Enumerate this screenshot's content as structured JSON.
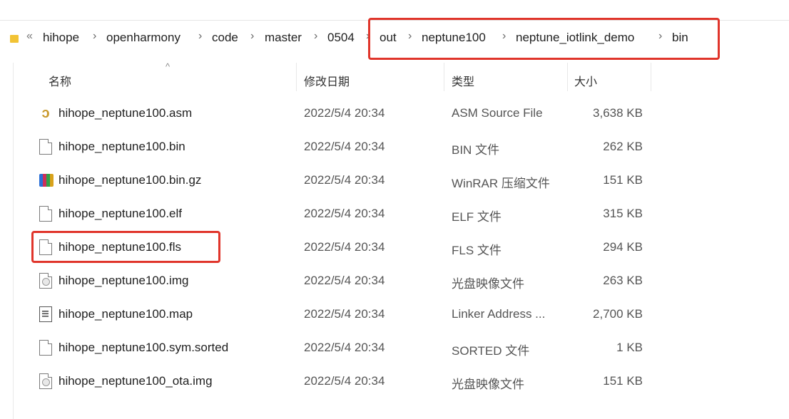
{
  "breadcrumb": {
    "overflow": "«",
    "separator": "›",
    "segments": [
      "hihope",
      "openharmony",
      "code",
      "master",
      "0504",
      "out",
      "neptune100",
      "neptune_iotlink_demo",
      "bin"
    ]
  },
  "columns": {
    "name": "名称",
    "date": "修改日期",
    "type": "类型",
    "size": "大小"
  },
  "files": [
    {
      "name": "hihope_neptune100.asm",
      "date": "2022/5/4 20:34",
      "type": "ASM Source File",
      "size": "3,638 KB",
      "icon": "asm-file-icon"
    },
    {
      "name": "hihope_neptune100.bin",
      "date": "2022/5/4 20:34",
      "type": "BIN 文件",
      "size": "262 KB",
      "icon": "file-icon"
    },
    {
      "name": "hihope_neptune100.bin.gz",
      "date": "2022/5/4 20:34",
      "type": "WinRAR 压缩文件",
      "size": "151 KB",
      "icon": "winrar-icon"
    },
    {
      "name": "hihope_neptune100.elf",
      "date": "2022/5/4 20:34",
      "type": "ELF 文件",
      "size": "315 KB",
      "icon": "file-icon"
    },
    {
      "name": "hihope_neptune100.fls",
      "date": "2022/5/4 20:34",
      "type": "FLS 文件",
      "size": "294 KB",
      "icon": "file-icon"
    },
    {
      "name": "hihope_neptune100.img",
      "date": "2022/5/4 20:34",
      "type": "光盘映像文件",
      "size": "263 KB",
      "icon": "disc-image-icon"
    },
    {
      "name": "hihope_neptune100.map",
      "date": "2022/5/4 20:34",
      "type": "Linker Address ...",
      "size": "2,700 KB",
      "icon": "text-file-icon"
    },
    {
      "name": "hihope_neptune100.sym.sorted",
      "date": "2022/5/4 20:34",
      "type": "SORTED 文件",
      "size": "1 KB",
      "icon": "file-icon"
    },
    {
      "name": "hihope_neptune100_ota.img",
      "date": "2022/5/4 20:34",
      "type": "光盘映像文件",
      "size": "151 KB",
      "icon": "disc-image-icon"
    }
  ],
  "colors": {
    "highlight": "#e0352b",
    "folder": "#f2c335"
  }
}
